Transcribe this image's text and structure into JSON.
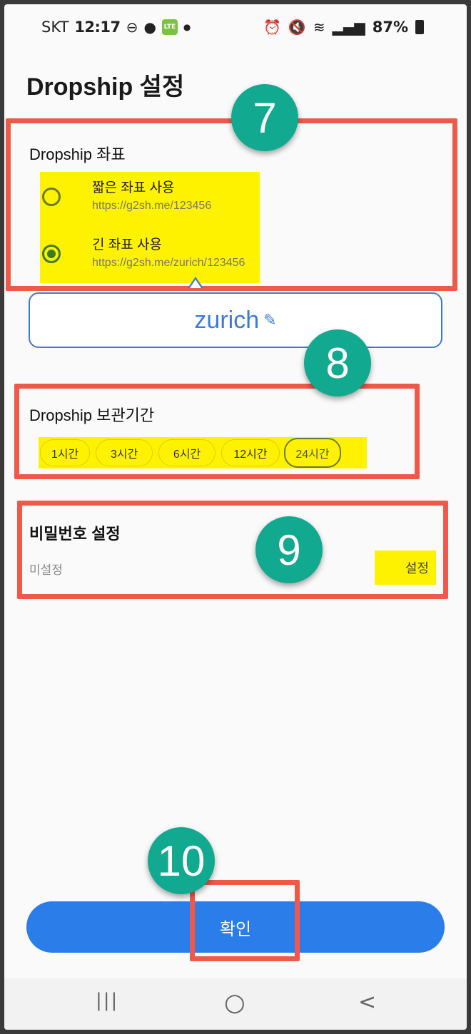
{
  "status_bar": {
    "carrier": "SKT",
    "time": "12:17",
    "network": "LTE",
    "battery": "87%",
    "icons": [
      "dnd-icon",
      "chat-icon",
      "lte-icon",
      "dot-icon",
      "alarm-icon",
      "mute-icon",
      "wifi-icon",
      "signal-icon",
      "battery-icon"
    ]
  },
  "page": {
    "title": "Dropship 설정"
  },
  "coord_section": {
    "title": "Dropship 좌표",
    "options": [
      {
        "label": "짧은 좌표 사용",
        "url": "https://g2sh.me/123456",
        "checked": false
      },
      {
        "label": "긴 좌표 사용",
        "url": "https://g2sh.me/zurich/123456",
        "checked": true
      }
    ],
    "field_value": "zurich"
  },
  "retention_section": {
    "title": "Dropship 보관기간",
    "chips": [
      "1시간",
      "3시간",
      "6시간",
      "12시간",
      "24시간"
    ],
    "selected": "24시간"
  },
  "password_section": {
    "title": "비밀번호 설정",
    "status": "미설정",
    "action": "설정"
  },
  "confirm_button": {
    "label": "확인"
  },
  "annotations": [
    "7",
    "8",
    "9",
    "10"
  ],
  "nav": {
    "recent": "|||",
    "home": "○",
    "back": "<"
  },
  "colors": {
    "accent": "#2b7de9",
    "highlight_red": "#f0584a",
    "highlight_yellow": "#fff200",
    "badge_teal": "#11a98f",
    "radio_green": "#3b7a1e"
  }
}
